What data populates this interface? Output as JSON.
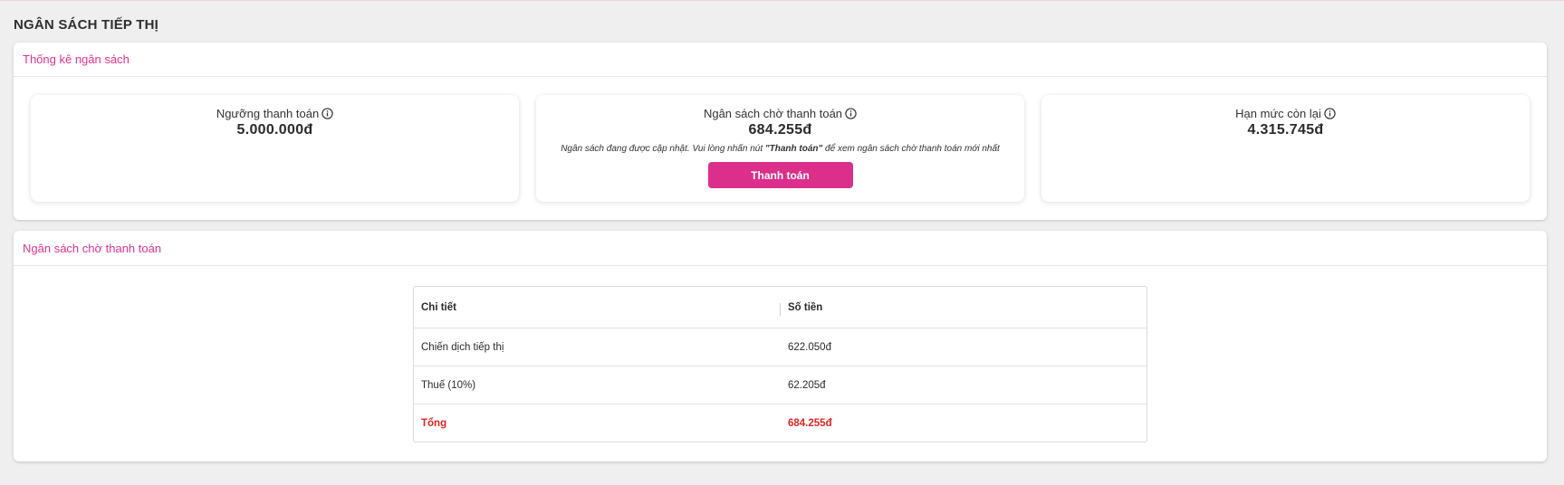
{
  "page": {
    "title": "NGÂN SÁCH TIẾP THỊ"
  },
  "stats_card": {
    "header": "Thống kê ngân sách",
    "threshold": {
      "label": "Ngưỡng thanh toán",
      "value": "5.000.000đ",
      "icon": "info-icon"
    },
    "pending": {
      "label": "Ngân sách chờ thanh toán",
      "value": "684.255đ",
      "icon": "info-icon",
      "note_before": "Ngân sách đang được cập nhật. Vui lòng nhấn nút ",
      "note_bold": "\"Thanh toán\"",
      "note_after": " để xem ngân sách chờ thanh toán mới nhất",
      "button_label": "Thanh toán"
    },
    "remaining": {
      "label": "Hạn mức còn lại",
      "value": "4.315.745đ",
      "icon": "info-icon"
    }
  },
  "pending_card": {
    "header": "Ngân sách chờ thanh toán",
    "columns": [
      "Chi tiết",
      "Số tiền"
    ],
    "rows": [
      {
        "detail": "Chiến dịch tiếp thị",
        "amount": "622.050đ"
      },
      {
        "detail": "Thuế (10%)",
        "amount": "62.205đ"
      }
    ],
    "total": {
      "detail": "Tổng",
      "amount": "684.255đ"
    }
  },
  "colors": {
    "accent": "#db2f8b",
    "header_text": "#e0338f",
    "total_text": "#e02424"
  }
}
